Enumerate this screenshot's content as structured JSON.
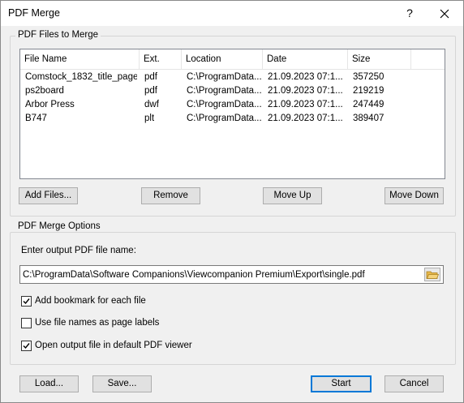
{
  "window": {
    "title": "PDF Merge",
    "help": "?"
  },
  "files_group": {
    "label": "PDF Files to Merge",
    "columns": [
      "File Name",
      "Ext.",
      "Location",
      "Date",
      "Size"
    ],
    "rows": [
      {
        "name": "Comstock_1832_title_page",
        "ext": "pdf",
        "location": "C:\\ProgramData...",
        "date": "21.09.2023  07:1...",
        "size": "357250"
      },
      {
        "name": "ps2board",
        "ext": "pdf",
        "location": "C:\\ProgramData...",
        "date": "21.09.2023  07:1...",
        "size": "219219"
      },
      {
        "name": "Arbor Press",
        "ext": "dwf",
        "location": "C:\\ProgramData...",
        "date": "21.09.2023  07:1...",
        "size": "247449"
      },
      {
        "name": "B747",
        "ext": "plt",
        "location": "C:\\ProgramData...",
        "date": "21.09.2023  07:1...",
        "size": "389407"
      }
    ],
    "buttons": {
      "add": "Add Files...",
      "remove": "Remove",
      "move_up": "Move Up",
      "move_down": "Move Down"
    }
  },
  "options_group": {
    "label": "PDF Merge Options",
    "output_prompt": "Enter output PDF file name:",
    "output_path": "C:\\ProgramData\\Software Companions\\Viewcompanion Premium\\Export\\single.pdf",
    "checkboxes": [
      {
        "label": "Add bookmark for each file",
        "checked": true
      },
      {
        "label": "Use file names as page labels",
        "checked": false
      },
      {
        "label": "Open output file in default PDF viewer",
        "checked": true
      }
    ]
  },
  "footer": {
    "load": "Load...",
    "save": "Save...",
    "start": "Start",
    "cancel": "Cancel"
  },
  "colors": {
    "accent": "#0078d7",
    "folder": "#e8b84a"
  }
}
